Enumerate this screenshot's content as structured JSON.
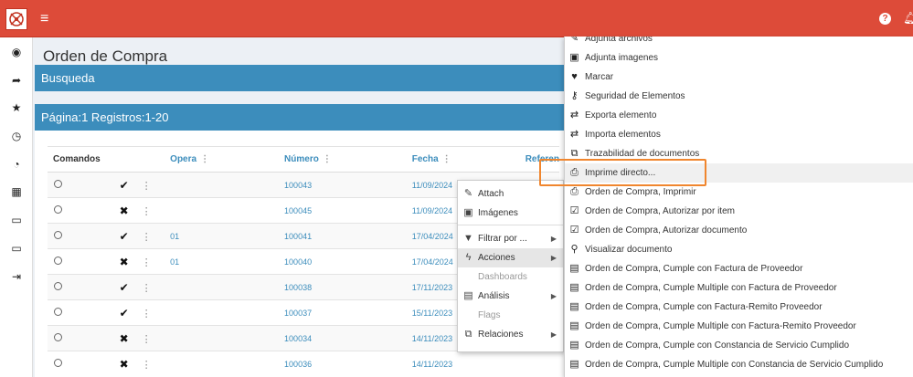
{
  "topbar": {
    "menu_icon": "≡",
    "help_icon": "?"
  },
  "page": {
    "title": "Orden de Compra"
  },
  "panels": {
    "busqueda": "Busqueda",
    "paging": "Página:1 Registros:1-20"
  },
  "table": {
    "headers": {
      "commands": "Comandos",
      "opera": "Opera",
      "numero": "Número",
      "fecha": "Fecha",
      "referencia": "Referen"
    },
    "rows": [
      {
        "icon": "✔",
        "opera": "",
        "numero": "100043",
        "fecha": "11/09/2024"
      },
      {
        "icon": "✖",
        "opera": "",
        "numero": "100045",
        "fecha": "11/09/2024"
      },
      {
        "icon": "✔",
        "opera": "01",
        "numero": "100041",
        "fecha": "17/04/2024"
      },
      {
        "icon": "✖",
        "opera": "01",
        "numero": "100040",
        "fecha": "17/04/2024"
      },
      {
        "icon": "✔",
        "opera": "",
        "numero": "100038",
        "fecha": "17/11/2023"
      },
      {
        "icon": "✔",
        "opera": "",
        "numero": "100037",
        "fecha": "15/11/2023"
      },
      {
        "icon": "✖",
        "opera": "",
        "numero": "100034",
        "fecha": "14/11/2023"
      },
      {
        "icon": "✖",
        "opera": "",
        "numero": "100036",
        "fecha": "14/11/2023"
      }
    ]
  },
  "context_menu": {
    "attach": "Attach",
    "imagenes": "Imágenes",
    "filtrar": "Filtrar por ...",
    "acciones": "Acciones",
    "dashboards": "Dashboards",
    "analisis": "Análisis",
    "flags": "Flags",
    "relaciones": "Relaciones"
  },
  "submenu": {
    "items": [
      "Adjunta archivos",
      "Adjunta imagenes",
      "Marcar",
      "Seguridad de Elementos",
      "Exporta elemento",
      "Importa elementos",
      "Trazabilidad de documentos",
      "Imprime directo...",
      "Orden de Compra, Imprimir",
      "Orden de Compra, Autorizar por item",
      "Orden de Compra, Autorizar documento",
      "Visualizar documento",
      "Orden de Compra, Cumple con Factura de Proveedor",
      "Orden de Compra, Cumple Multiple con Factura de Proveedor",
      "Orden de Compra, Cumple con Factura-Remito Proveedor",
      "Orden de Compra, Cumple Multiple con Factura-Remito Proveedor",
      "Orden de Compra, Cumple con Constancia de Servicio Cumplido",
      "Orden de Compra, Cumple Multiple con Constancia de Servicio Cumplido"
    ]
  },
  "colors": {
    "topbar": "#dd4b39",
    "panel": "#3c8dbc",
    "highlight": "#f0862e"
  }
}
